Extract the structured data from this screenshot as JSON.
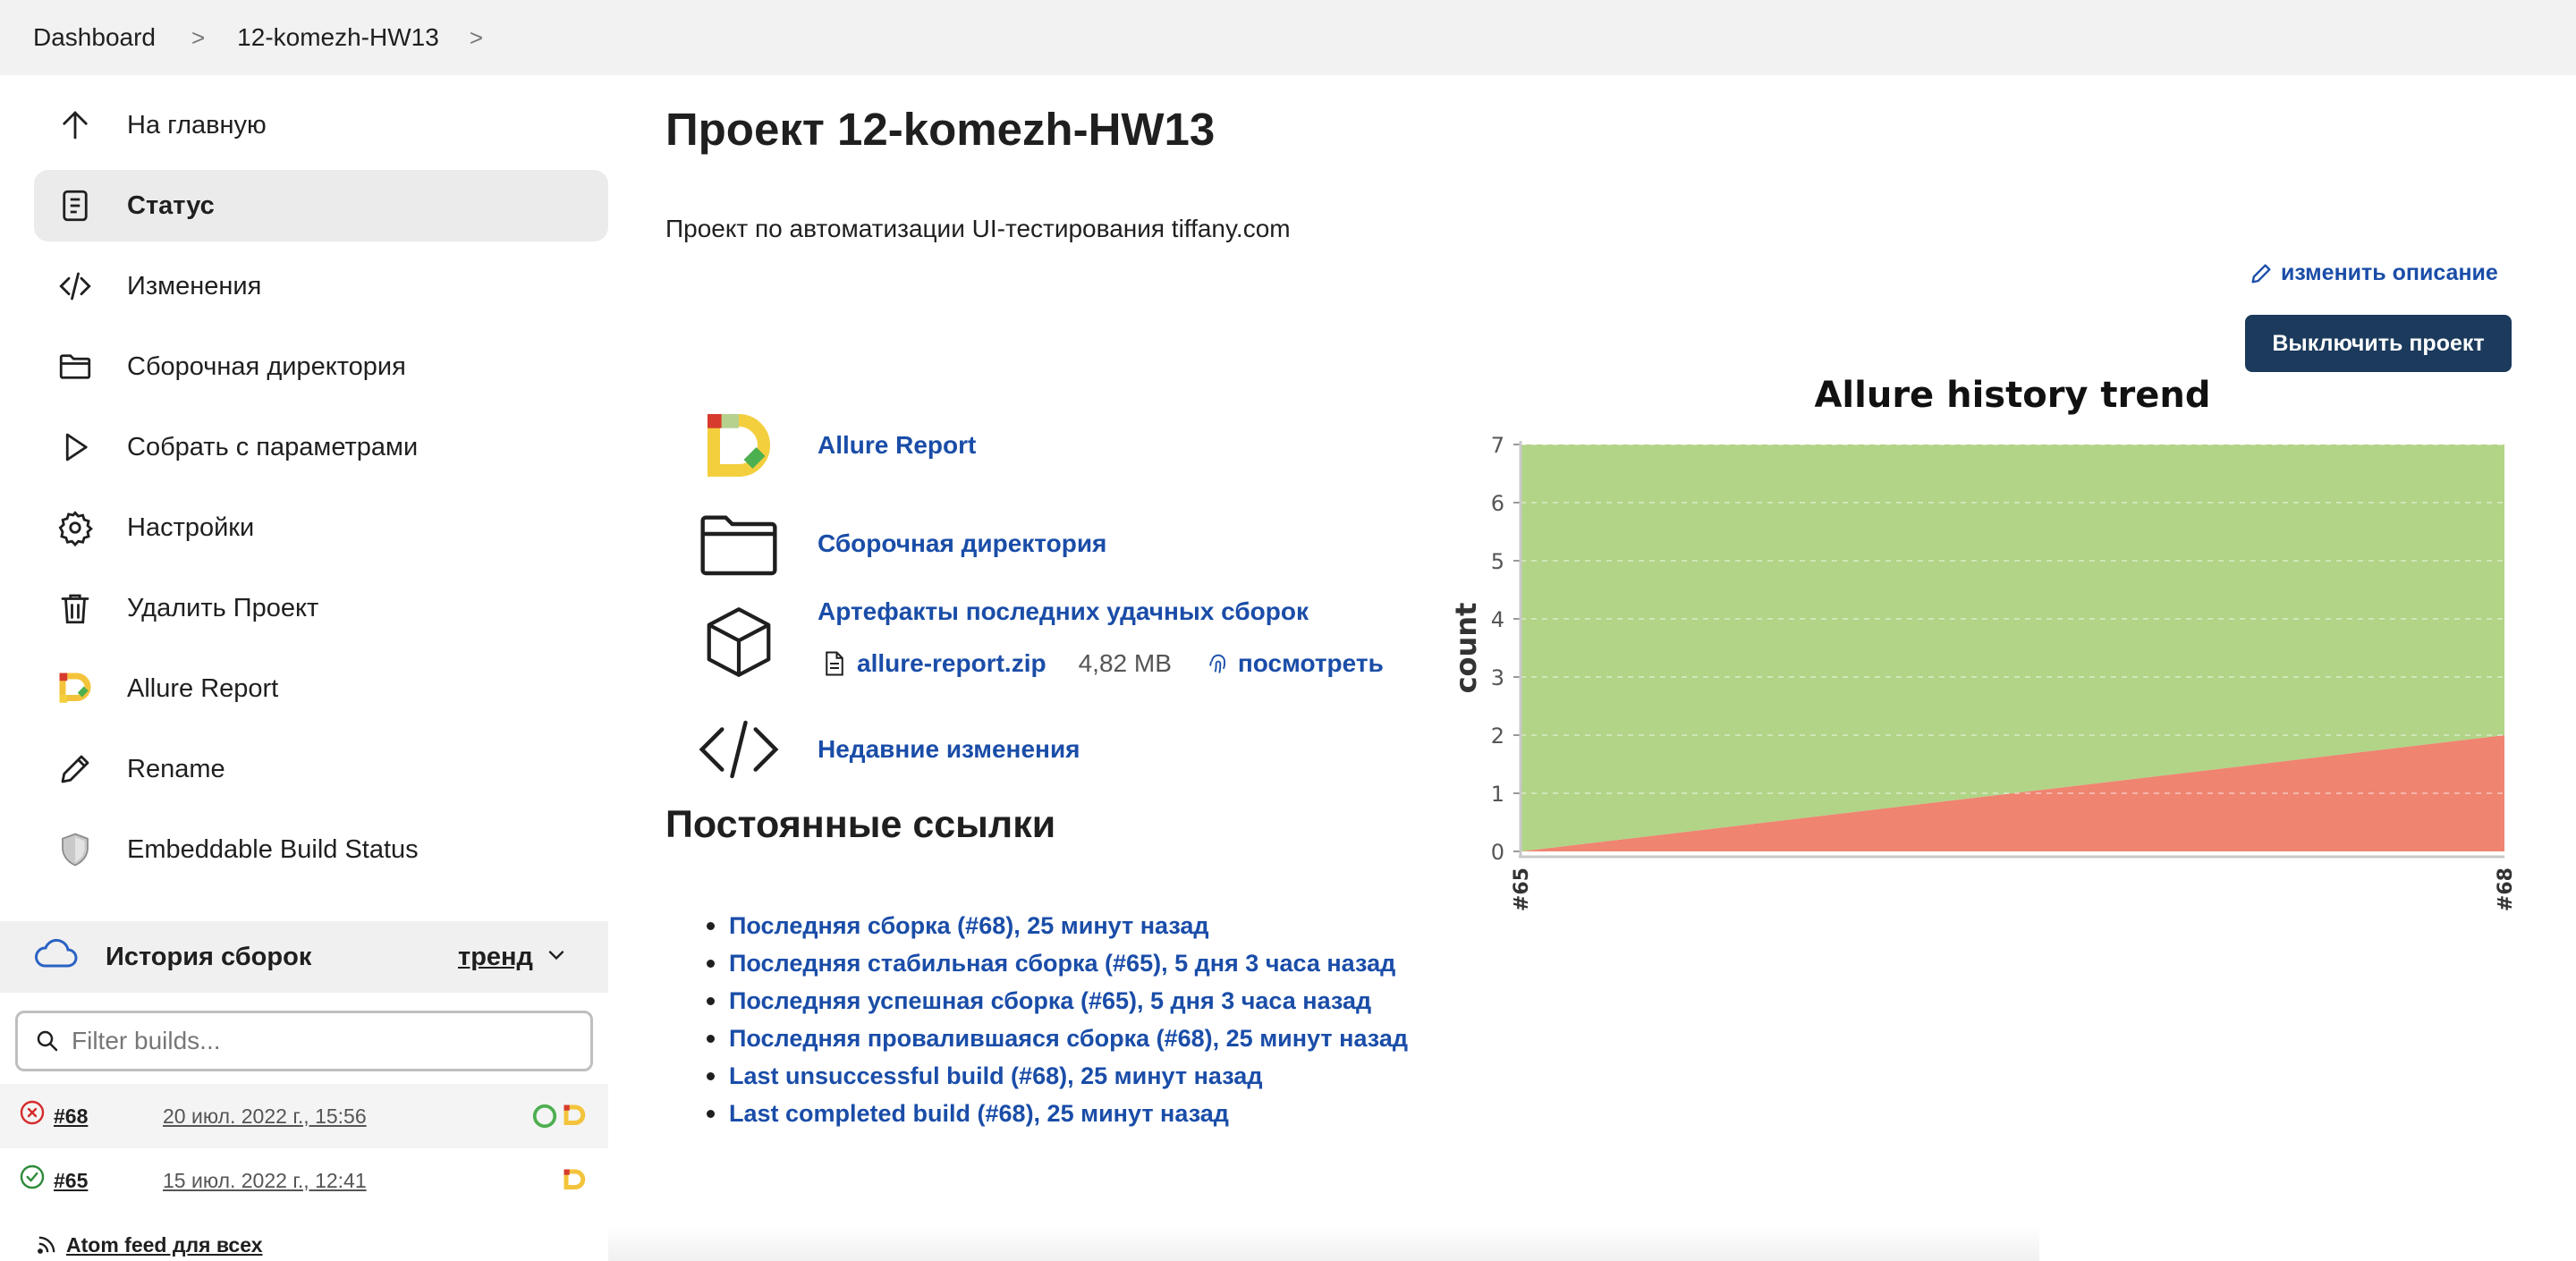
{
  "breadcrumb": {
    "items": [
      "Dashboard",
      "12-komezh-HW13"
    ],
    "separator": ">"
  },
  "sidebar": {
    "items": [
      {
        "label": "На главную",
        "icon": "arrow-up-icon"
      },
      {
        "label": "Статус",
        "icon": "document-icon",
        "active": true
      },
      {
        "label": "Изменения",
        "icon": "code-icon"
      },
      {
        "label": "Сборочная директория",
        "icon": "folder-icon"
      },
      {
        "label": "Собрать с параметрами",
        "icon": "play-icon"
      },
      {
        "label": "Настройки",
        "icon": "gear-icon"
      },
      {
        "label": "Удалить Проект",
        "icon": "trash-icon"
      },
      {
        "label": "Allure Report",
        "icon": "allure-icon"
      },
      {
        "label": "Rename",
        "icon": "pencil-icon"
      },
      {
        "label": "Embeddable Build Status",
        "icon": "shield-icon"
      }
    ]
  },
  "build_history": {
    "title": "История сборок",
    "trend_label": "тренд",
    "filter_placeholder": "Filter builds...",
    "builds": [
      {
        "number": "#68",
        "date": "20 июл. 2022 г., 15:56",
        "status": "failed"
      },
      {
        "number": "#65",
        "date": "15 июл. 2022 г., 12:41",
        "status": "success"
      }
    ],
    "atom_feed": "Atom feed для всех"
  },
  "main": {
    "title": "Проект 12-komezh-HW13",
    "description": "Проект по автоматизации UI-тестирования tiffany.com",
    "edit_description": "изменить описание",
    "disable_button": "Выключить проект",
    "links": {
      "allure": "Allure Report",
      "workspace": "Сборочная директория",
      "artifacts": "Артефакты последних удачных сборок",
      "recent_changes": "Недавние изменения"
    },
    "artifact": {
      "file": "allure-report.zip",
      "size": "4,82 MB",
      "view": "посмотреть"
    },
    "permalinks_title": "Постоянные ссылки",
    "permalinks": [
      "Последняя сборка (#68), 25 минут назад",
      "Последняя стабильная сборка (#65), 5 дня 3 часа назад",
      "Последняя успешная сборка (#65), 5 дня 3 часа назад",
      "Последняя провалившаяся сборка (#68), 25 минут назад",
      "Last unsuccessful build (#68), 25 минут назад",
      "Last completed build (#68), 25 минут назад"
    ]
  },
  "colors": {
    "link": "#1a4da8",
    "passed": "#b1d487",
    "failed": "#ef8470",
    "button_bg": "#1b3a5c"
  },
  "chart_data": {
    "type": "area",
    "title": "Allure history trend",
    "ylabel": "count",
    "xlabel": "",
    "x": [
      "#65",
      "#68"
    ],
    "ylim": [
      0,
      7
    ],
    "yticks": [
      0,
      1,
      2,
      3,
      4,
      5,
      6,
      7
    ],
    "stacked": true,
    "grid": true,
    "series": [
      {
        "values": [
          0,
          2
        ],
        "color": "#ef8470"
      },
      {
        "values": [
          7,
          5
        ],
        "color": "#b1d487"
      }
    ]
  }
}
